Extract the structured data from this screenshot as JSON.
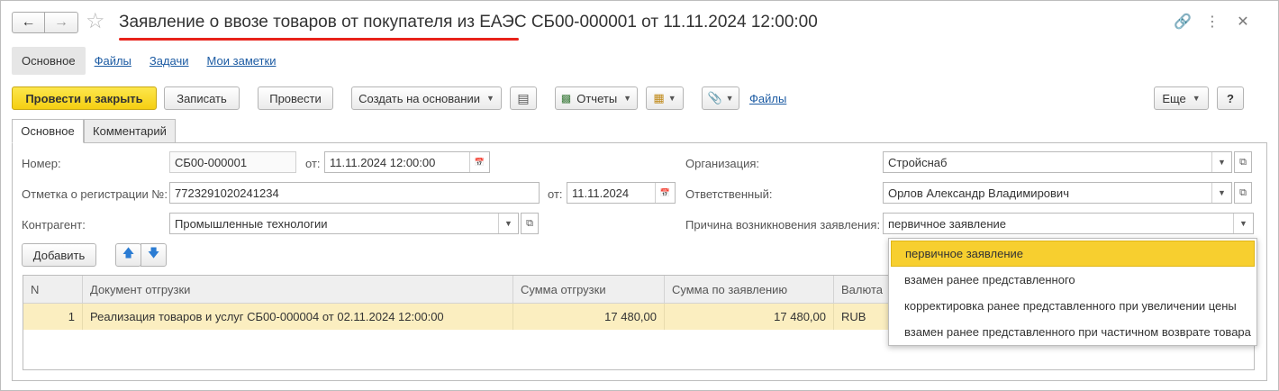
{
  "header": {
    "title": "Заявление о ввозе товаров от покупателя из ЕАЭС СБ00-000001 от 11.11.2024 12:00:00",
    "back_icon": "arrow-left-icon",
    "forward_icon": "arrow-right-icon",
    "favorite_icon": "star-icon",
    "link_icon": "link-icon",
    "more_icon": "more-vertical-icon",
    "close_icon": "close-icon"
  },
  "section_nav": {
    "items": [
      "Основное",
      "Файлы",
      "Задачи",
      "Мои заметки"
    ]
  },
  "toolbar": {
    "post_close": "Провести и закрыть",
    "save": "Записать",
    "post": "Провести",
    "create_based": "Создать на основании",
    "reports": "Отчеты",
    "files": "Файлы",
    "more": "Еще",
    "help": "?"
  },
  "tabs": [
    "Основное",
    "Комментарий"
  ],
  "form": {
    "number_label": "Номер:",
    "number_value": "СБ00-000001",
    "date_label": "от:",
    "date_value": "11.11.2024 12:00:00",
    "reg_label": "Отметка о регистрации №:",
    "reg_value": "7723291020241234",
    "reg_date_label": "от:",
    "reg_date_value": "11.11.2024",
    "counterparty_label": "Контрагент:",
    "counterparty_value": "Промышленные технологии",
    "org_label": "Организация:",
    "org_value": "Стройснаб",
    "responsible_label": "Ответственный:",
    "responsible_value": "Орлов Александр Владимирович",
    "reason_label": "Причина возникновения заявления:",
    "reason_value": "первичное заявление"
  },
  "table_toolbar": {
    "add": "Добавить"
  },
  "table": {
    "columns": [
      "N",
      "Документ отгрузки",
      "Сумма отгрузки",
      "Сумма по заявлению",
      "Валюта"
    ],
    "rows": [
      {
        "n": "1",
        "doc": "Реализация товаров и услуг СБ00-000004 от 02.11.2024 12:00:00",
        "sum_ship": "17 480,00",
        "sum_decl": "17 480,00",
        "currency": "RUB"
      }
    ]
  },
  "reason_dropdown": {
    "options": [
      "первичное заявление",
      "взамен ранее представленного",
      "корректировка ранее представленного при увеличении цены",
      "взамен ранее представленного при частичном возврате товара"
    ],
    "selected_index": 0
  },
  "colors": {
    "primary_button": "#f5cf12",
    "title_underline": "#e8231b",
    "link": "#1c5ba3",
    "selected_row": "#fbeec0",
    "selected_option": "#f7cf2f"
  }
}
